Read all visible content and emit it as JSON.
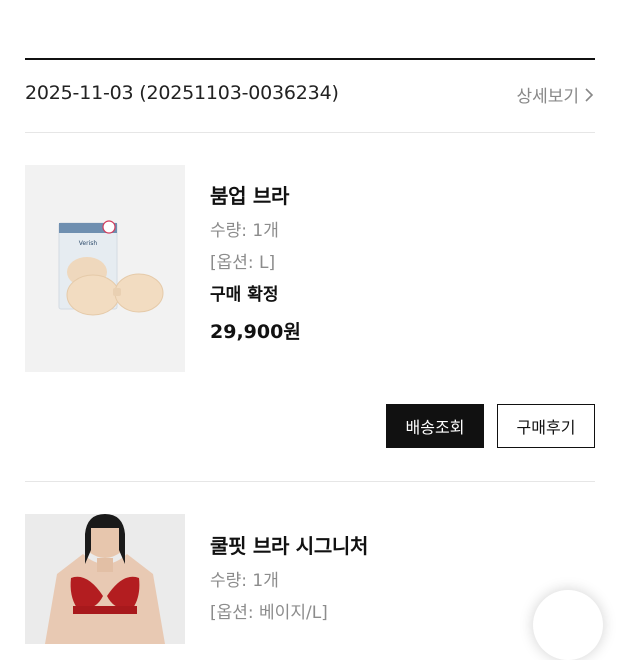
{
  "order": {
    "date_line": "2025-11-03 (20251103-0036234)",
    "detail_label": "상세보기"
  },
  "products": [
    {
      "name": "붐업 브라",
      "quantity": "수량: 1개",
      "option": "[옵션: L]",
      "status": "구매 확정",
      "price": "29,900원",
      "package_brand": "Verish"
    },
    {
      "name": "쿨핏 브라 시그니처",
      "quantity": "수량: 1개",
      "option": "[옵션: 베이지/L]"
    }
  ],
  "actions": {
    "track_label": "배송조회",
    "review_label": "구매후기"
  },
  "icons": {
    "detail_arrow": "chevron-right-icon",
    "floating": "floating-action-button"
  },
  "colors": {
    "primary_button": "#111111",
    "muted_text": "#8c8c8c"
  }
}
